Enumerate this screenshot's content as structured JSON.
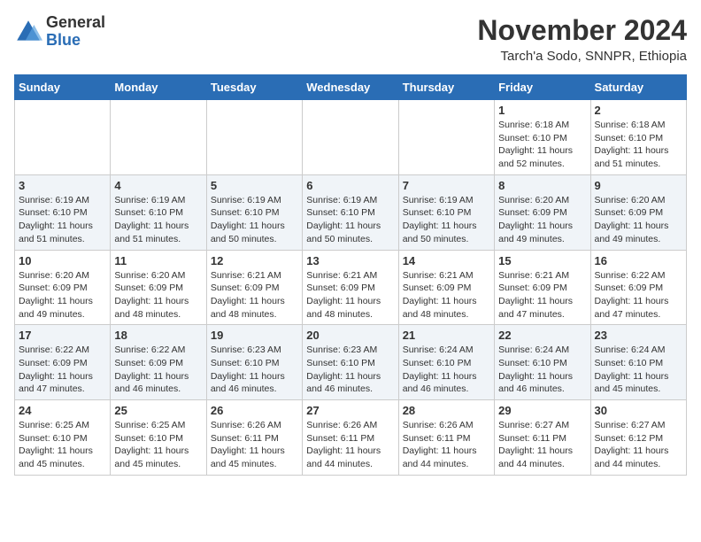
{
  "header": {
    "logo_general": "General",
    "logo_blue": "Blue",
    "month_title": "November 2024",
    "location": "Tarch'a Sodo, SNNPR, Ethiopia"
  },
  "weekdays": [
    "Sunday",
    "Monday",
    "Tuesday",
    "Wednesday",
    "Thursday",
    "Friday",
    "Saturday"
  ],
  "weeks": [
    [
      {
        "day": "",
        "detail": ""
      },
      {
        "day": "",
        "detail": ""
      },
      {
        "day": "",
        "detail": ""
      },
      {
        "day": "",
        "detail": ""
      },
      {
        "day": "",
        "detail": ""
      },
      {
        "day": "1",
        "detail": "Sunrise: 6:18 AM\nSunset: 6:10 PM\nDaylight: 11 hours and 52 minutes."
      },
      {
        "day": "2",
        "detail": "Sunrise: 6:18 AM\nSunset: 6:10 PM\nDaylight: 11 hours and 51 minutes."
      }
    ],
    [
      {
        "day": "3",
        "detail": "Sunrise: 6:19 AM\nSunset: 6:10 PM\nDaylight: 11 hours and 51 minutes."
      },
      {
        "day": "4",
        "detail": "Sunrise: 6:19 AM\nSunset: 6:10 PM\nDaylight: 11 hours and 51 minutes."
      },
      {
        "day": "5",
        "detail": "Sunrise: 6:19 AM\nSunset: 6:10 PM\nDaylight: 11 hours and 50 minutes."
      },
      {
        "day": "6",
        "detail": "Sunrise: 6:19 AM\nSunset: 6:10 PM\nDaylight: 11 hours and 50 minutes."
      },
      {
        "day": "7",
        "detail": "Sunrise: 6:19 AM\nSunset: 6:10 PM\nDaylight: 11 hours and 50 minutes."
      },
      {
        "day": "8",
        "detail": "Sunrise: 6:20 AM\nSunset: 6:09 PM\nDaylight: 11 hours and 49 minutes."
      },
      {
        "day": "9",
        "detail": "Sunrise: 6:20 AM\nSunset: 6:09 PM\nDaylight: 11 hours and 49 minutes."
      }
    ],
    [
      {
        "day": "10",
        "detail": "Sunrise: 6:20 AM\nSunset: 6:09 PM\nDaylight: 11 hours and 49 minutes."
      },
      {
        "day": "11",
        "detail": "Sunrise: 6:20 AM\nSunset: 6:09 PM\nDaylight: 11 hours and 48 minutes."
      },
      {
        "day": "12",
        "detail": "Sunrise: 6:21 AM\nSunset: 6:09 PM\nDaylight: 11 hours and 48 minutes."
      },
      {
        "day": "13",
        "detail": "Sunrise: 6:21 AM\nSunset: 6:09 PM\nDaylight: 11 hours and 48 minutes."
      },
      {
        "day": "14",
        "detail": "Sunrise: 6:21 AM\nSunset: 6:09 PM\nDaylight: 11 hours and 48 minutes."
      },
      {
        "day": "15",
        "detail": "Sunrise: 6:21 AM\nSunset: 6:09 PM\nDaylight: 11 hours and 47 minutes."
      },
      {
        "day": "16",
        "detail": "Sunrise: 6:22 AM\nSunset: 6:09 PM\nDaylight: 11 hours and 47 minutes."
      }
    ],
    [
      {
        "day": "17",
        "detail": "Sunrise: 6:22 AM\nSunset: 6:09 PM\nDaylight: 11 hours and 47 minutes."
      },
      {
        "day": "18",
        "detail": "Sunrise: 6:22 AM\nSunset: 6:09 PM\nDaylight: 11 hours and 46 minutes."
      },
      {
        "day": "19",
        "detail": "Sunrise: 6:23 AM\nSunset: 6:10 PM\nDaylight: 11 hours and 46 minutes."
      },
      {
        "day": "20",
        "detail": "Sunrise: 6:23 AM\nSunset: 6:10 PM\nDaylight: 11 hours and 46 minutes."
      },
      {
        "day": "21",
        "detail": "Sunrise: 6:24 AM\nSunset: 6:10 PM\nDaylight: 11 hours and 46 minutes."
      },
      {
        "day": "22",
        "detail": "Sunrise: 6:24 AM\nSunset: 6:10 PM\nDaylight: 11 hours and 46 minutes."
      },
      {
        "day": "23",
        "detail": "Sunrise: 6:24 AM\nSunset: 6:10 PM\nDaylight: 11 hours and 45 minutes."
      }
    ],
    [
      {
        "day": "24",
        "detail": "Sunrise: 6:25 AM\nSunset: 6:10 PM\nDaylight: 11 hours and 45 minutes."
      },
      {
        "day": "25",
        "detail": "Sunrise: 6:25 AM\nSunset: 6:10 PM\nDaylight: 11 hours and 45 minutes."
      },
      {
        "day": "26",
        "detail": "Sunrise: 6:26 AM\nSunset: 6:11 PM\nDaylight: 11 hours and 45 minutes."
      },
      {
        "day": "27",
        "detail": "Sunrise: 6:26 AM\nSunset: 6:11 PM\nDaylight: 11 hours and 44 minutes."
      },
      {
        "day": "28",
        "detail": "Sunrise: 6:26 AM\nSunset: 6:11 PM\nDaylight: 11 hours and 44 minutes."
      },
      {
        "day": "29",
        "detail": "Sunrise: 6:27 AM\nSunset: 6:11 PM\nDaylight: 11 hours and 44 minutes."
      },
      {
        "day": "30",
        "detail": "Sunrise: 6:27 AM\nSunset: 6:12 PM\nDaylight: 11 hours and 44 minutes."
      }
    ]
  ]
}
